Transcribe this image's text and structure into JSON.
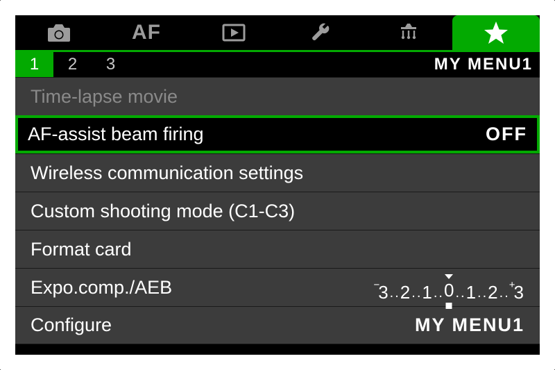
{
  "tabs": {
    "icons": [
      "camera",
      "af",
      "playback",
      "wrench",
      "custom",
      "star"
    ],
    "active_index": 5,
    "af_label": "AF"
  },
  "pages": {
    "numbers": [
      "1",
      "2",
      "3"
    ],
    "active_index": 0,
    "label": "MY MENU1"
  },
  "menu": {
    "items": [
      {
        "label": "Time-lapse movie",
        "value": "",
        "disabled": true,
        "selected": false
      },
      {
        "label": "AF-assist beam firing",
        "value": "OFF",
        "disabled": false,
        "selected": true
      },
      {
        "label": "Wireless communication settings",
        "value": "",
        "disabled": false,
        "selected": false
      },
      {
        "label": "Custom shooting mode (C1-C3)",
        "value": "",
        "disabled": false,
        "selected": false
      },
      {
        "label": "Format card",
        "value": "",
        "disabled": false,
        "selected": false
      },
      {
        "label": "Expo.comp./AEB",
        "value": "",
        "disabled": false,
        "selected": false,
        "expo": true
      },
      {
        "label": "Configure",
        "value": "MY MENU1",
        "disabled": false,
        "selected": false
      }
    ]
  },
  "expo_scale": {
    "left_sign": "−",
    "majors_left": [
      "3",
      "2",
      "1"
    ],
    "center": "0",
    "majors_right": [
      "1",
      "2",
      "3"
    ],
    "right_sign": "+"
  }
}
